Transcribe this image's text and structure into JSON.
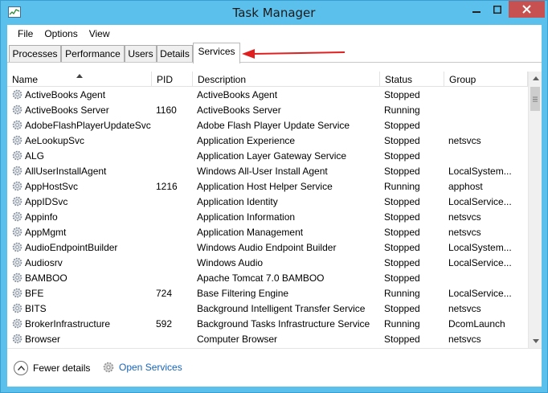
{
  "window": {
    "title": "Task Manager"
  },
  "menu": [
    "File",
    "Options",
    "View"
  ],
  "tabs": [
    "Processes",
    "Performance",
    "Users",
    "Details",
    "Services"
  ],
  "active_tab": "Services",
  "columns": {
    "name": "Name",
    "pid": "PID",
    "description": "Description",
    "status": "Status",
    "group": "Group"
  },
  "rows": [
    {
      "name": "ActiveBooks Agent",
      "pid": "",
      "description": "ActiveBooks Agent",
      "status": "Stopped",
      "group": ""
    },
    {
      "name": "ActiveBooks Server",
      "pid": "1160",
      "description": "ActiveBooks Server",
      "status": "Running",
      "group": ""
    },
    {
      "name": "AdobeFlashPlayerUpdateSvc",
      "pid": "",
      "description": "Adobe Flash Player Update Service",
      "status": "Stopped",
      "group": ""
    },
    {
      "name": "AeLookupSvc",
      "pid": "",
      "description": "Application Experience",
      "status": "Stopped",
      "group": "netsvcs"
    },
    {
      "name": "ALG",
      "pid": "",
      "description": "Application Layer Gateway Service",
      "status": "Stopped",
      "group": ""
    },
    {
      "name": "AllUserInstallAgent",
      "pid": "",
      "description": "Windows All-User Install Agent",
      "status": "Stopped",
      "group": "LocalSystem..."
    },
    {
      "name": "AppHostSvc",
      "pid": "1216",
      "description": "Application Host Helper Service",
      "status": "Running",
      "group": "apphost"
    },
    {
      "name": "AppIDSvc",
      "pid": "",
      "description": "Application Identity",
      "status": "Stopped",
      "group": "LocalService..."
    },
    {
      "name": "Appinfo",
      "pid": "",
      "description": "Application Information",
      "status": "Stopped",
      "group": "netsvcs"
    },
    {
      "name": "AppMgmt",
      "pid": "",
      "description": "Application Management",
      "status": "Stopped",
      "group": "netsvcs"
    },
    {
      "name": "AudioEndpointBuilder",
      "pid": "",
      "description": "Windows Audio Endpoint Builder",
      "status": "Stopped",
      "group": "LocalSystem..."
    },
    {
      "name": "Audiosrv",
      "pid": "",
      "description": "Windows Audio",
      "status": "Stopped",
      "group": "LocalService..."
    },
    {
      "name": "BAMBOO",
      "pid": "",
      "description": "Apache Tomcat 7.0 BAMBOO",
      "status": "Stopped",
      "group": ""
    },
    {
      "name": "BFE",
      "pid": "724",
      "description": "Base Filtering Engine",
      "status": "Running",
      "group": "LocalService..."
    },
    {
      "name": "BITS",
      "pid": "",
      "description": "Background Intelligent Transfer Service",
      "status": "Stopped",
      "group": "netsvcs"
    },
    {
      "name": "BrokerInfrastructure",
      "pid": "592",
      "description": "Background Tasks Infrastructure Service",
      "status": "Running",
      "group": "DcomLaunch"
    },
    {
      "name": "Browser",
      "pid": "",
      "description": "Computer Browser",
      "status": "Stopped",
      "group": "netsvcs"
    }
  ],
  "footer": {
    "fewer_details": "Fewer details",
    "open_services": "Open Services"
  },
  "colors": {
    "titlebar": "#5cc0ec",
    "close_button": "#c75050",
    "link": "#1664b9",
    "annotation_arrow": "#e02020"
  }
}
